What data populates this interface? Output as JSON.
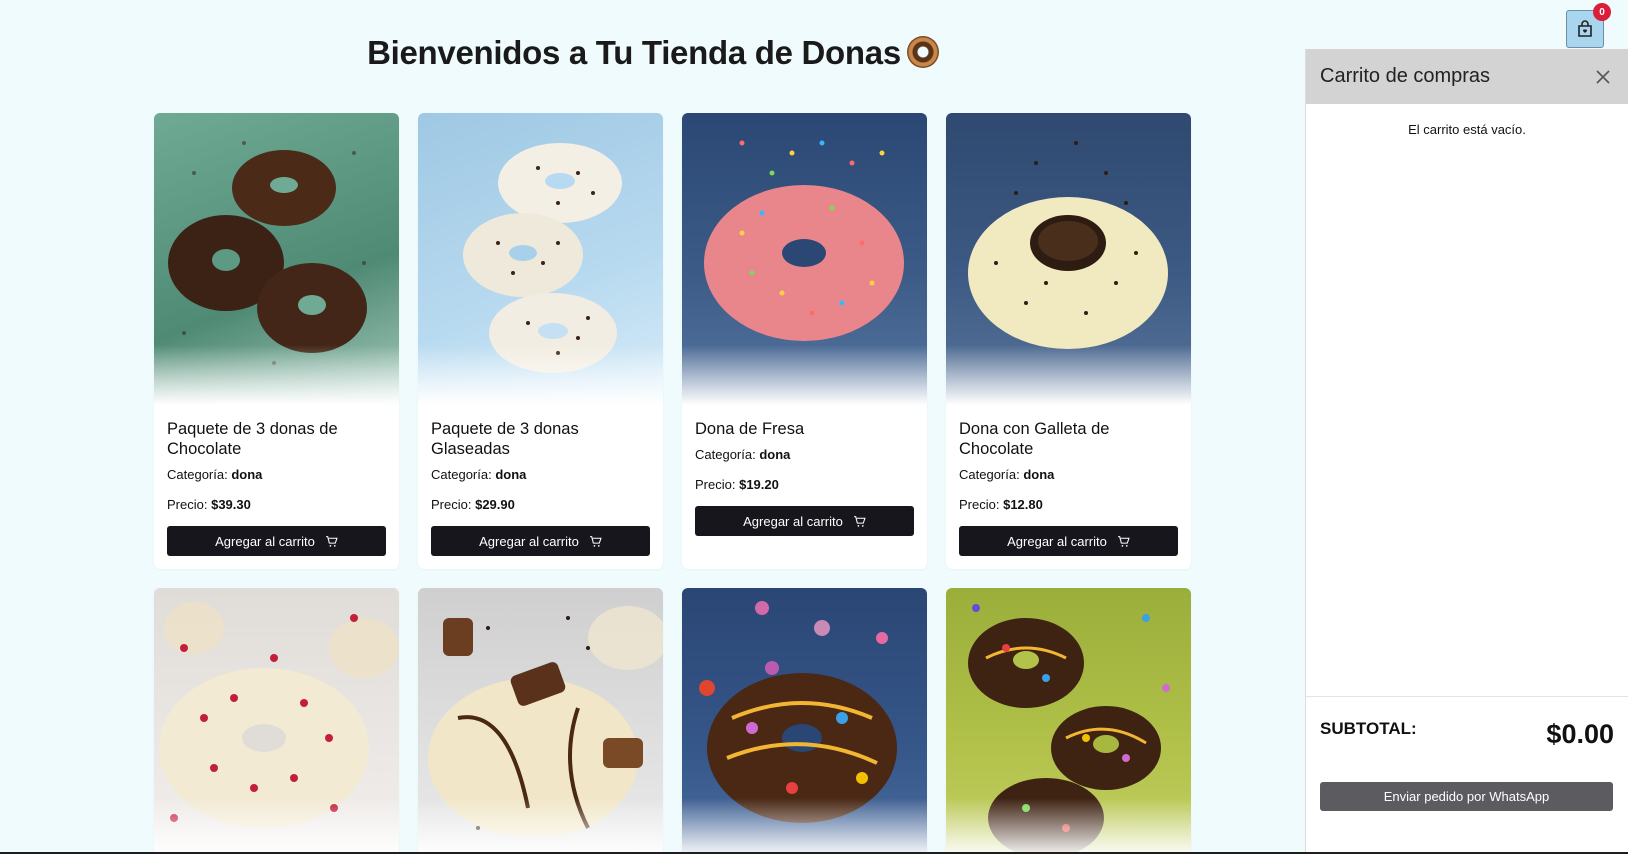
{
  "header": {
    "title": "Bienvenidos a Tu Tienda de Donas"
  },
  "products": [
    {
      "name": "Paquete de 3 donas de Chocolate",
      "category_label": "Categoría:",
      "category": "dona",
      "price_label": "Precio:",
      "price": "$39.30",
      "button": "Agregar al carrito"
    },
    {
      "name": "Paquete de 3 donas Glaseadas",
      "category_label": "Categoría:",
      "category": "dona",
      "price_label": "Precio:",
      "price": "$29.90",
      "button": "Agregar al carrito"
    },
    {
      "name": "Dona de Fresa",
      "category_label": "Categoría:",
      "category": "dona",
      "price_label": "Precio:",
      "price": "$19.20",
      "button": "Agregar al carrito"
    },
    {
      "name": "Dona con Galleta de Chocolate",
      "category_label": "Categoría:",
      "category": "dona",
      "price_label": "Precio:",
      "price": "$12.80",
      "button": "Agregar al carrito"
    }
  ],
  "cart": {
    "badge_count": "0",
    "title": "Carrito de compras",
    "empty_message": "El carrito está vacío.",
    "subtotal_label": "SUBTOTAL:",
    "subtotal_value": "$0.00",
    "whatsapp_button": "Enviar pedido por WhatsApp"
  },
  "colors": {
    "button_dark": "#16161c",
    "badge": "#d91e3a",
    "cart_toggle": "#a9d6ee",
    "page_bg": "#f0fbfe"
  },
  "icons": {
    "cart_toggle": "shopping-bag-icon",
    "add_button": "cart-icon",
    "close": "close-icon"
  }
}
